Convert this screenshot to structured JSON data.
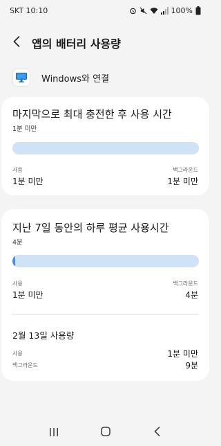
{
  "status_bar": {
    "carrier_time": "SKT 10:10",
    "battery": "100%"
  },
  "header": {
    "title": "앱의 배터리 사용량",
    "back_icon": "chevron-left-icon"
  },
  "app": {
    "name": "Windows와 연결",
    "icon": "windows-link-icon"
  },
  "since_full_charge": {
    "title": "마지막으로 최대 충전한 후 사용 시간",
    "total": "1분 미만",
    "fraction": 0,
    "usage_label": "사용",
    "usage_value": "1분 미만",
    "background_label": "백그라운드",
    "background_value": "1분 미만"
  },
  "last_7_days": {
    "title": "지난 7일 동안의 하루 평균 사용시간",
    "total": "4분",
    "fraction": 0.01,
    "usage_label": "사용",
    "usage_value": "1분 미만",
    "background_label": "백그라운드",
    "background_value": "4분"
  },
  "day_usage": {
    "title": "2월 13일 사용량",
    "usage_label": "사용",
    "usage_value": "1분 미만",
    "background_label": "백그라운드",
    "background_value": "9분"
  },
  "colors": {
    "bar_track": "#cfe2f6",
    "bar_fill": "#4a8fd8",
    "background": "#f4f4f4"
  },
  "nav": {
    "recents_icon": "recents-icon",
    "home_icon": "home-icon",
    "back_icon": "back-icon"
  }
}
